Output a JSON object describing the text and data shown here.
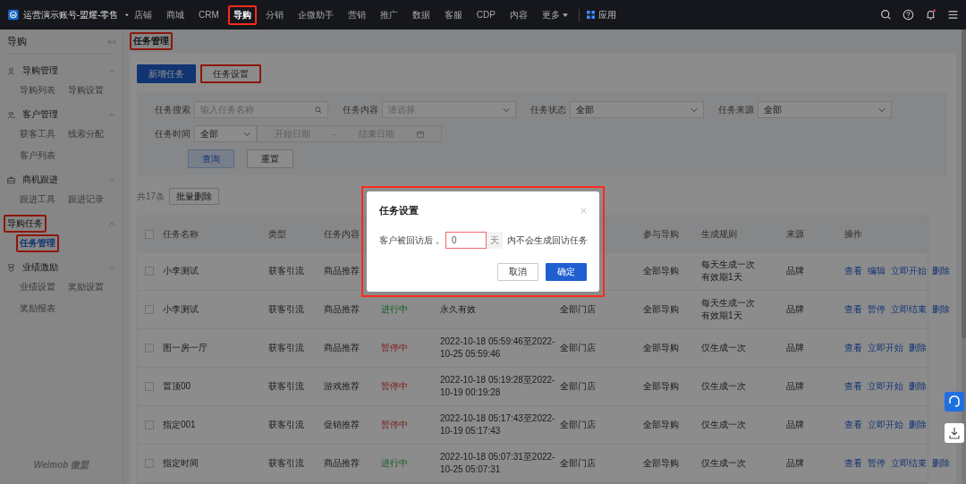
{
  "top_bar": {
    "account": "运营演示账号-盟耀-零售",
    "nav": [
      {
        "label": "店铺",
        "selected": false,
        "highlighted": false,
        "dropdown": false
      },
      {
        "label": "商城",
        "selected": false,
        "highlighted": false,
        "dropdown": false
      },
      {
        "label": "CRM",
        "selected": false,
        "highlighted": false,
        "dropdown": false
      },
      {
        "label": "导购",
        "selected": true,
        "highlighted": true,
        "dropdown": false
      },
      {
        "label": "分销",
        "selected": false,
        "highlighted": false,
        "dropdown": false
      },
      {
        "label": "企微助手",
        "selected": false,
        "highlighted": false,
        "dropdown": false
      },
      {
        "label": "营销",
        "selected": false,
        "highlighted": false,
        "dropdown": false
      },
      {
        "label": "推广",
        "selected": false,
        "highlighted": false,
        "dropdown": false
      },
      {
        "label": "数据",
        "selected": false,
        "highlighted": false,
        "dropdown": false
      },
      {
        "label": "客服",
        "selected": false,
        "highlighted": false,
        "dropdown": false
      },
      {
        "label": "CDP",
        "selected": false,
        "highlighted": false,
        "dropdown": false
      },
      {
        "label": "内容",
        "selected": false,
        "highlighted": false,
        "dropdown": false
      },
      {
        "label": "更多",
        "selected": false,
        "highlighted": false,
        "dropdown": true
      }
    ],
    "apps": "应用",
    "notification_dot": true
  },
  "sidebar": {
    "title": "导购",
    "footer": "Weimob 微盟",
    "groups": [
      {
        "label": "导购管理",
        "expanded": true,
        "highlighted": false,
        "items": [
          {
            "label": "导购列表",
            "selected": false,
            "highlighted": false
          },
          {
            "label": "导购设置",
            "selected": false,
            "highlighted": false
          }
        ]
      },
      {
        "label": "客户管理",
        "expanded": true,
        "highlighted": false,
        "items": [
          {
            "label": "获客工具",
            "selected": false,
            "highlighted": false
          },
          {
            "label": "线索分配",
            "selected": false,
            "highlighted": false
          },
          {
            "label": "客户列表",
            "selected": false,
            "highlighted": false
          }
        ]
      },
      {
        "label": "商机跟进",
        "expanded": true,
        "highlighted": false,
        "items": [
          {
            "label": "跟进工具",
            "selected": false,
            "highlighted": false
          },
          {
            "label": "跟进记录",
            "selected": false,
            "highlighted": false
          }
        ]
      },
      {
        "label": "导购任务",
        "expanded": true,
        "highlighted": true,
        "items": [
          {
            "label": "任务管理",
            "selected": true,
            "highlighted": true
          }
        ]
      },
      {
        "label": "业绩激励",
        "expanded": true,
        "highlighted": false,
        "items": [
          {
            "label": "业绩设置",
            "selected": false,
            "highlighted": false
          },
          {
            "label": "奖励设置",
            "selected": false,
            "highlighted": false
          },
          {
            "label": "奖励报表",
            "selected": false,
            "highlighted": false
          }
        ]
      }
    ]
  },
  "breadcrumb": {
    "label": "任务管理",
    "highlighted": true
  },
  "toolbar": [
    {
      "label": "新增任务",
      "kind": "primary",
      "highlighted": false
    },
    {
      "label": "任务设置",
      "kind": "default",
      "highlighted": true
    }
  ],
  "filters": {
    "search": {
      "label": "任务搜索",
      "placeholder": "输入任务名称"
    },
    "selects": [
      {
        "label": "任务内容",
        "placeholder": "请选择"
      },
      {
        "label": "任务状态",
        "value": "全部"
      },
      {
        "label": "任务来源",
        "value": "全部"
      }
    ],
    "time": {
      "label": "任务时间",
      "value": "全部",
      "start_placeholder": "开始日期",
      "separator": "-",
      "end_placeholder": "结束日期"
    },
    "buttons": [
      {
        "label": "查询",
        "kind": "primary"
      },
      {
        "label": "重置",
        "kind": "default"
      }
    ]
  },
  "list_bar": {
    "count": "共17条",
    "bulk_delete": "批量删除"
  },
  "table": {
    "all_checked": false,
    "columns": [
      {
        "label": "任务名称"
      },
      {
        "label": "类型"
      },
      {
        "label": "任务内容"
      },
      {},
      {},
      {},
      {
        "label": "参与导购"
      },
      {
        "label": "生成规则"
      },
      {
        "label": "来源"
      },
      {
        "label": "操作"
      }
    ],
    "rows": [
      {
        "checked": false,
        "name": "小李测试",
        "type": "获客引流",
        "content": "商品推荐",
        "guides": "全部导购",
        "rule": [
          "每天生成一次",
          "有效期1天"
        ],
        "source": "品牌",
        "actions": [
          "查看",
          "编辑",
          "立即开始",
          "删除"
        ]
      },
      {
        "checked": false,
        "name": "小李测试",
        "type": "获客引流",
        "content": "商品推荐",
        "status": {
          "text": "进行中",
          "kind": "running"
        },
        "time": [
          "永久有效"
        ],
        "store": "全部门店",
        "guides": "全部导购",
        "rule": [
          "每天生成一次",
          "有效期1天"
        ],
        "source": "品牌",
        "actions": [
          "查看",
          "暂停",
          "立即结束",
          "删除"
        ]
      },
      {
        "checked": false,
        "name": "图一房一厅",
        "type": "获客引流",
        "content": "商品推荐",
        "status": {
          "text": "暂停中",
          "kind": "paused"
        },
        "time": [
          "2022-10-18 05:59:46至2022-",
          "10-25 05:59:46"
        ],
        "store": "全部门店",
        "guides": "全部导购",
        "rule": [
          "仅生成一次"
        ],
        "source": "品牌",
        "actions": [
          "查看",
          "立即开始",
          "删除"
        ]
      },
      {
        "checked": false,
        "name": "置顶00",
        "type": "获客引流",
        "content": "游戏推荐",
        "status": {
          "text": "暂停中",
          "kind": "paused"
        },
        "time": [
          "2022-10-18 05:19:28至2022-",
          "10-19 00:19:28"
        ],
        "store": "全部门店",
        "guides": "全部导购",
        "rule": [
          "仅生成一次"
        ],
        "source": "品牌",
        "actions": [
          "查看",
          "立即开始",
          "删除"
        ]
      },
      {
        "checked": false,
        "name": "指定001",
        "type": "获客引流",
        "content": "促销推荐",
        "status": {
          "text": "暂停中",
          "kind": "paused"
        },
        "time": [
          "2022-10-18 05:17:43至2022-",
          "10-19 05:17:43"
        ],
        "store": "全部门店",
        "guides": "全部导购",
        "rule": [
          "仅生成一次"
        ],
        "source": "品牌",
        "actions": [
          "查看",
          "立即开始",
          "删除"
        ]
      },
      {
        "checked": false,
        "name": "指定时间",
        "type": "获客引流",
        "content": "商品推荐",
        "status": {
          "text": "进行中",
          "kind": "running"
        },
        "time": [
          "2022-10-18 05:07:31至2022-",
          "10-25 05:07:31"
        ],
        "store": "全部门店",
        "guides": "全部导购",
        "rule": [
          "仅生成一次"
        ],
        "source": "品牌",
        "actions": [
          "查看",
          "暂停",
          "立即结束",
          "删除"
        ]
      }
    ]
  },
  "modal": {
    "title": "任务设置",
    "highlighted": true,
    "prefix": "客户被回访后，",
    "value": "0",
    "error": true,
    "unit": "天",
    "suffix": "内不会生成回访任务",
    "buttons": [
      {
        "label": "取消",
        "kind": "default"
      },
      {
        "label": "确定",
        "kind": "primary"
      }
    ]
  }
}
